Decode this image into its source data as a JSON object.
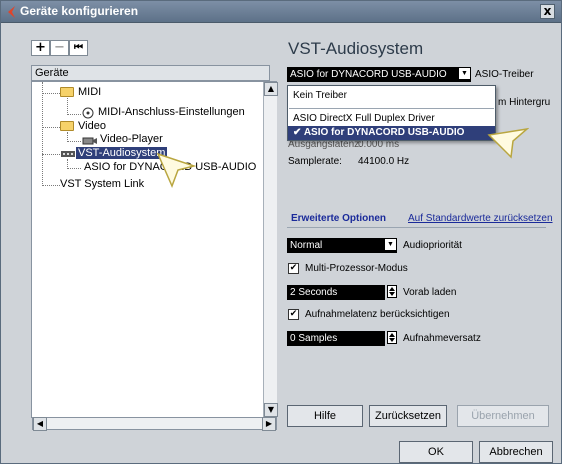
{
  "window": {
    "title": "Geräte konfigurieren",
    "close_label": "x"
  },
  "tree_toolbar": {
    "add": "+",
    "remove": "−",
    "reset": "⏮"
  },
  "tree": {
    "header": "Geräte",
    "items": [
      {
        "label": "MIDI"
      },
      {
        "label": "MIDI-Anschluss-Einstellungen"
      },
      {
        "label": "Video"
      },
      {
        "label": "Video-Player"
      },
      {
        "label": "VST-Audiosystem"
      },
      {
        "label": "ASIO for DYNACORD USB-AUDIO"
      },
      {
        "label": "VST System Link"
      }
    ]
  },
  "panel": {
    "title": "VST-Audiosystem",
    "driver": {
      "value": "ASIO for DYNACORD USB-AUDIO",
      "label": "ASIO-Treiber"
    },
    "hintergrund_label": "m Hintergru",
    "popup": {
      "items": [
        "Kein Treiber",
        "ASIO DirectX Full Duplex Driver",
        "ASIO for DYNACORD USB-AUDIO"
      ],
      "check": "✔"
    },
    "ausgangslatenz_label": "Ausgangslatenz:",
    "ausgangslatenz_value": "0.000 ms",
    "samplerate_label": "Samplerate:",
    "samplerate_value": "44100.0 Hz",
    "advanced_title": "Erweiterte Optionen",
    "reset_defaults": "Auf Standardwerte zurücksetzen",
    "priority": {
      "value": "Normal",
      "label": "Audiopriorität"
    },
    "multiprocessor": {
      "checked": true,
      "label": "Multi-Prozessor-Modus"
    },
    "preload": {
      "value": "2 Seconds",
      "label": "Vorab laden"
    },
    "latency_comp": {
      "checked": true,
      "label": "Aufnahmelatenz berücksichtigen"
    },
    "rec_offset": {
      "value": "0 Samples",
      "label": "Aufnahmeversatz"
    }
  },
  "buttons": {
    "help": "Hilfe",
    "reset": "Zurücksetzen",
    "apply": "Übernehmen",
    "ok": "OK",
    "cancel": "Abbrechen"
  },
  "colors": {
    "selection": "#2f3f7a",
    "titlebar": "#5d7188",
    "link": "#1a2a9a"
  }
}
